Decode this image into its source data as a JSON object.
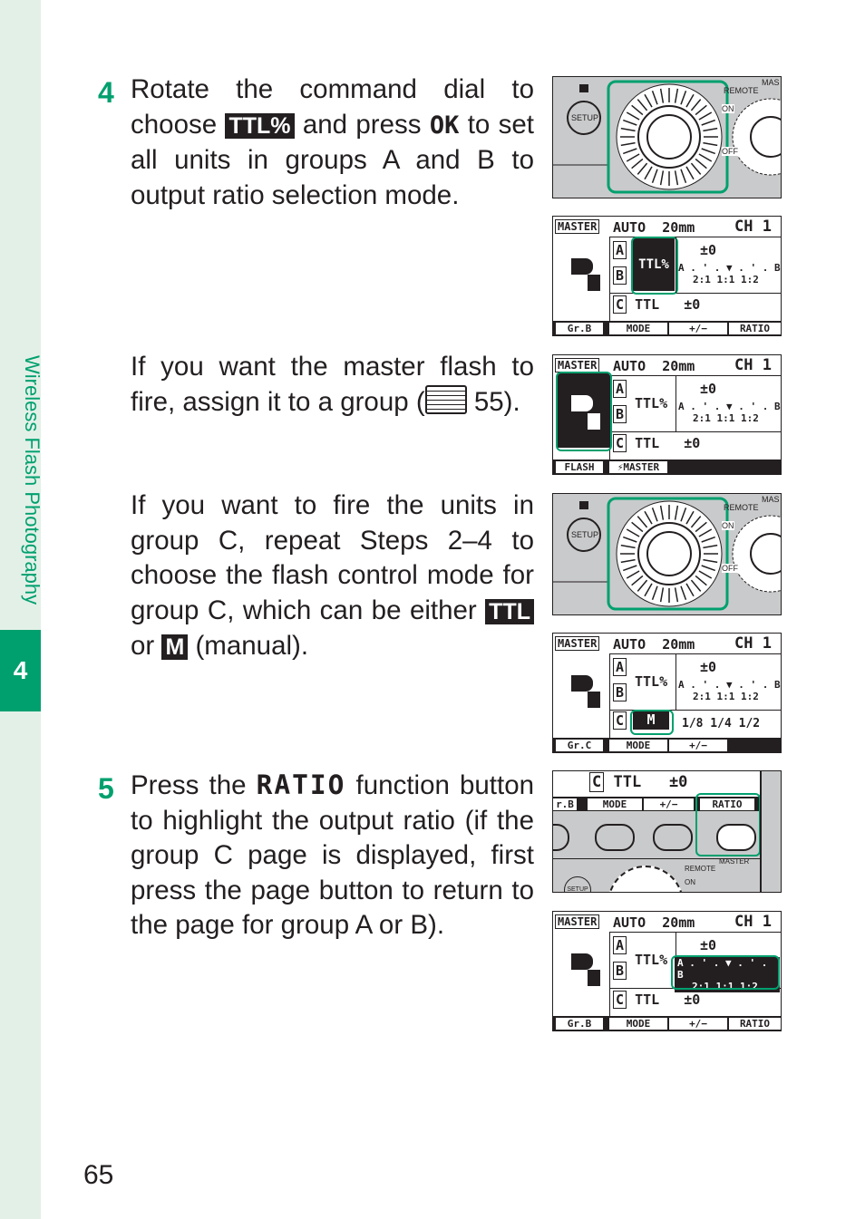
{
  "sidebar": {
    "title": "Wireless Flash Photography",
    "chapter": "4"
  },
  "page_number": "65",
  "step4": {
    "number": "4",
    "t1": "Rotate the command dial to choose ",
    "icon": "TTL%",
    "t2": " and press ",
    "ok": "OK",
    "t3": " to set all units in groups A and B to output ratio selection mode."
  },
  "note1": {
    "t1": "If you want the master flash to fire, assign it to a group (",
    "book_icon": "book-icon",
    "t2": " 55)."
  },
  "note2": {
    "t1": "If you want to fire the units in group C, repeat Steps 2–4 to choose the flash control mode for group C, which can be either ",
    "ttl": "TTL",
    "t2": " or ",
    "m": "M",
    "t3": " (manual)."
  },
  "step5": {
    "number": "5",
    "t1": "Press the ",
    "ratio": "RATIO",
    "t2": " function button to highlight the output ratio (if the group C page is displayed, first press the page button to return to the page for group A or B)."
  },
  "dial": {
    "setup": "SETUP",
    "remote": "REMOTE",
    "master": "MAS",
    "on": "ON",
    "off": "OFF"
  },
  "lcd": {
    "master": "MASTER",
    "auto": "AUTO",
    "zoom": "20mm",
    "ch": "CH 1",
    "a": "A",
    "b": "B",
    "c": "C",
    "ttlp": "TTL%",
    "ttl": "TTL",
    "pm0": "±0",
    "m": "M",
    "ratio_scale": "A . ' . ▼ . ' . B",
    "ratios": "2:1  1:1  1:2",
    "manual": "1/8  1/4  1/2",
    "mode": "MODE",
    "pm": "+/−",
    "ratio": "RATIO",
    "grb": "Gr.B",
    "grc": "Gr.C",
    "flash": "FLASH",
    "smaster": "⚡MASTER"
  },
  "buttons": {
    "c": "C",
    "ttl": "TTL",
    "pm0": "±0",
    "grb": "r.B",
    "mode": "MODE",
    "pm": "+/−",
    "ratio": "RATIO",
    "remote": "REMOTE",
    "master": "MASTER",
    "on": "ON",
    "setup": "SETUP"
  },
  "colors": {
    "accent": "#00a06e",
    "panel": "#c9cacb"
  }
}
